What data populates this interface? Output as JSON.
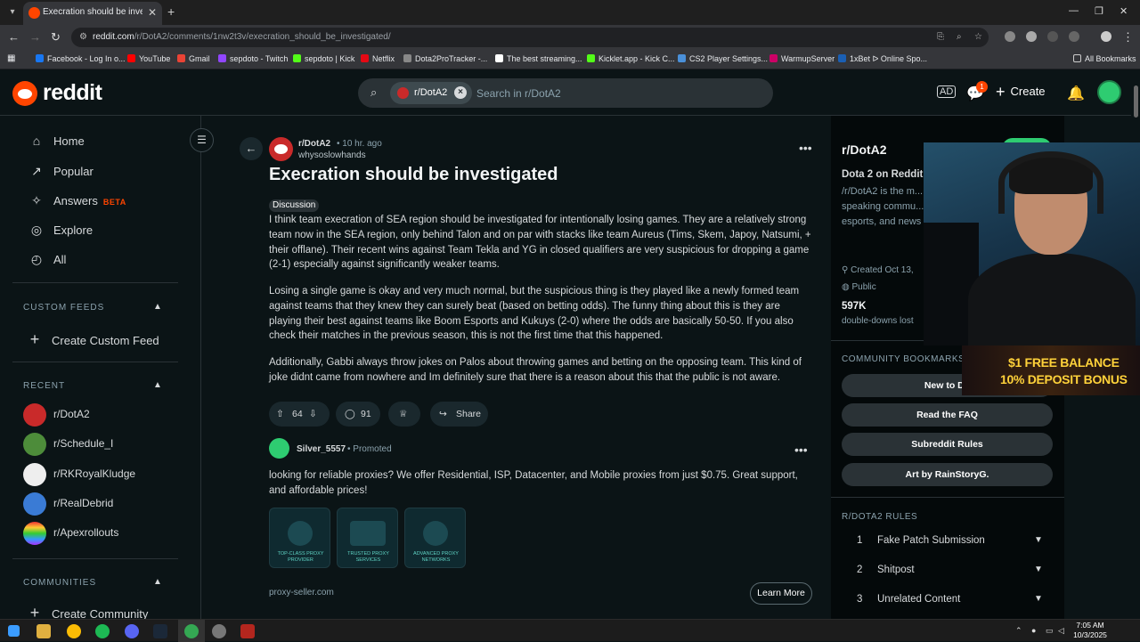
{
  "browser": {
    "tab_title": "Execration should be investigated",
    "url_host": "reddit.com",
    "url_path": "/r/DotA2/comments/1nw2t3v/execration_should_be_investigated/",
    "bookmarks": [
      "Facebook - Log In o...",
      "YouTube",
      "Gmail",
      "sepdoto - Twitch",
      "sepdoto | Kick",
      "Netflix",
      "Dota2ProTracker -...",
      "The best streaming...",
      "Kicklet.app - Kick C...",
      "CS2 Player Settings...",
      "WarmupServer",
      "1xBet ᐅ Online Spo..."
    ],
    "all_bookmarks": "All Bookmarks"
  },
  "header": {
    "logo_text": "reddit",
    "search_chip": "r/DotA2",
    "search_placeholder": "Search in r/DotA2",
    "notif_count": "1",
    "create_label": "Create"
  },
  "sidebar": {
    "nav": [
      {
        "label": "Home",
        "icon": "home-icon"
      },
      {
        "label": "Popular",
        "icon": "popular-icon"
      },
      {
        "label": "Answers",
        "icon": "answers-icon",
        "badge": "BETA"
      },
      {
        "label": "Explore",
        "icon": "explore-icon"
      },
      {
        "label": "All",
        "icon": "all-icon"
      }
    ],
    "custom_feeds_title": "CUSTOM FEEDS",
    "create_custom_feed": "Create Custom Feed",
    "recent_title": "RECENT",
    "recent": [
      "r/DotA2",
      "r/Schedule_I",
      "r/RKRoyalKludge",
      "r/RealDebrid",
      "r/Apexrollouts"
    ],
    "communities_title": "COMMUNITIES",
    "create_community": "Create Community"
  },
  "post": {
    "subreddit": "r/DotA2",
    "time": "• 10 hr. ago",
    "author": "whysoslowhands",
    "title": "Execration should be investigated",
    "flair": "Discussion",
    "paragraphs": [
      "I think team execration of SEA region should be investigated for intentionally losing games. They are a relatively strong team now in the SEA region, only behind Talon and on par with stacks like team Aureus (Tims, Skem, Japoy, Natsumi, + their offlane). Their recent wins against Team Tekla and YG in closed qualifiers are very suspicious for dropping a game (2-1) especially against significantly weaker teams.",
      "Losing a single game is okay and very much normal, but the suspicious thing is they played like a newly formed team against teams that they knew they can surely beat (based on betting odds). The funny thing about this is they are playing their best against teams like Boom Esports and Kukuys (2-0) where the odds are basically 50-50. If you also check their matches in the previous season, this is not the first time that this happened.",
      "Additionally, Gabbi always throw jokes on Palos about throwing games and betting on the opposing team. This kind of joke didnt came from nowhere and Im definitely sure that there is a reason about this that the public is not aware."
    ],
    "votes": "64",
    "comments": "91",
    "share": "Share"
  },
  "promo": {
    "name": "Silver_5557",
    "tag": "Promoted",
    "text": "looking for reliable proxies? We offer Residential, ISP, Datacenter, and Mobile proxies from just $0.75. Great support, and affordable prices!",
    "cards": [
      "TOP-CLASS PROXY PROVIDER",
      "TRUSTED PROXY SERVICES",
      "ADVANCED PROXY NETWORKS"
    ],
    "domain": "proxy-seller.com",
    "cta": "Learn More"
  },
  "right_panel": {
    "title": "r/DotA2",
    "desc_title": "Dota 2 on Reddit",
    "desc": "/r/DotA2 is the m... speaking commu... esports, and news",
    "created": "Created Oct 13,",
    "visibility": "Public",
    "members": "597K",
    "members_label": "double-downs lost",
    "bookmarks_title": "COMMUNITY BOOKMARKS",
    "bookmarks": [
      "New to Do",
      "Read the FAQ",
      "Subreddit Rules",
      "Art by RainStoryG."
    ],
    "rules_title": "R/DOTA2 RULES",
    "rules": [
      {
        "n": "1",
        "t": "Fake Patch Submission"
      },
      {
        "n": "2",
        "t": "Shitpost"
      },
      {
        "n": "3",
        "t": "Unrelated Content"
      }
    ]
  },
  "overlay": {
    "line1": "$1 FREE BALANCE",
    "line2": "10% DEPOSIT BONUS"
  },
  "taskbar": {
    "time": "7:05 AM",
    "date": "10/3/2025"
  }
}
